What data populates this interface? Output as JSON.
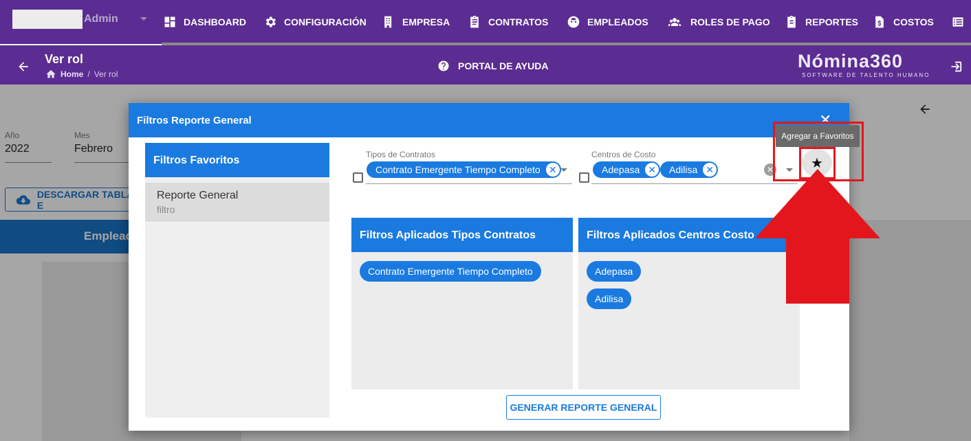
{
  "app": {
    "user_label": "Admin",
    "brand_logo": "Nómina360",
    "brand_tagline": "SOFTWARE DE TALENTO HUMANO"
  },
  "nav": [
    {
      "label": "DASHBOARD",
      "icon": "dashboard-icon"
    },
    {
      "label": "CONFIGURACIÓN",
      "icon": "gear-icon"
    },
    {
      "label": "EMPRESA",
      "icon": "building-icon"
    },
    {
      "label": "CONTRATOS",
      "icon": "clipboard-icon"
    },
    {
      "label": "EMPLEADOS",
      "icon": "face-icon"
    },
    {
      "label": "ROLES DE PAGO",
      "icon": "people-icon"
    },
    {
      "label": "REPORTES",
      "icon": "report-icon"
    },
    {
      "label": "COSTOS",
      "icon": "cost-file-icon"
    }
  ],
  "subheader": {
    "title": "Ver rol",
    "breadcrumb_home": "Home",
    "breadcrumb_current": "Ver rol",
    "help_label": "PORTAL DE AYUDA"
  },
  "background": {
    "year_label": "Año",
    "year_value": "2022",
    "month_label": "Mes",
    "month_value": "Febrero",
    "download_label": "DESCARGAR TABLA E",
    "employees_bar_label": "Emplead"
  },
  "dialog": {
    "title": "Filtros Reporte General",
    "close_symbol": "✕",
    "favorites": {
      "header": "Filtros Favoritos",
      "items": [
        {
          "title": "Reporte General",
          "subtitle": "filtro"
        }
      ]
    },
    "contract_types": {
      "label": "Tipos de Contratos",
      "chips": [
        "Contrato Emergente Tiempo Completo"
      ]
    },
    "cost_centers": {
      "label": "Centros de Costo",
      "chips": [
        "Adepasa",
        "Adilisa"
      ]
    },
    "applied_contracts": {
      "header": "Filtros Aplicados Tipos Contratos",
      "chips": [
        "Contrato Emergente Tiempo Completo"
      ]
    },
    "applied_costs": {
      "header": "Filtros Aplicados Centros Costo",
      "chips": [
        "Adepasa",
        "Adilisa"
      ]
    },
    "generate_label": "GENERAR REPORTE GENERAL",
    "star_symbol": "★",
    "tooltip": "Agregar a Favoritos"
  },
  "colors": {
    "nav_purple": "#5b2c91",
    "primary_blue": "#1a7ae0",
    "annotation_red": "#e3161d"
  }
}
